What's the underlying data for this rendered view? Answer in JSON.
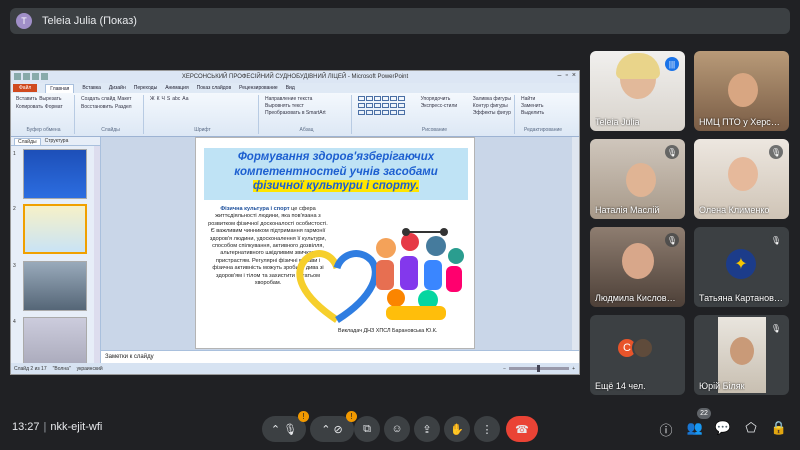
{
  "top": {
    "avatar_letter": "T",
    "title": "Teleia Julia (Показ)"
  },
  "powerpoint": {
    "window_title": "ХЕРСОНСЬКИЙ ПРОФЕСІЙНИЙ СУДНОБУДІВНИЙ ЛІЦЕЙ - Microsoft PowerPoint",
    "tabs": [
      "Файл",
      "Главная",
      "Вставка",
      "Дизайн",
      "Переходы",
      "Анимация",
      "Показ слайдов",
      "Рецензирование",
      "Вид"
    ],
    "ribbon_groups": [
      {
        "label": "Буфер обмена",
        "items": [
          "Вставить",
          "Вырезать",
          "Копировать",
          "Формат"
        ]
      },
      {
        "label": "Слайды",
        "items": [
          "Создать слайд",
          "Макет",
          "Восстановить",
          "Раздел"
        ]
      },
      {
        "label": "Шрифт",
        "items": [
          "Ж",
          "К",
          "Ч",
          "S",
          "abc",
          "Аа"
        ]
      },
      {
        "label": "Абзац",
        "items": [
          "Направление текста",
          "Выровнять текст",
          "Преобразовать в SmartArt"
        ]
      },
      {
        "label": "Рисование",
        "items": [
          "Упорядочить",
          "Экспресс-стили",
          "Заливка фигуры",
          "Контур фигуры",
          "Эффекты фигур"
        ]
      },
      {
        "label": "Редактирование",
        "items": [
          "Найти",
          "Заменить",
          "Выделить"
        ]
      }
    ],
    "pane_tabs": [
      "Слайды",
      "Структура"
    ],
    "thumb_numbers": [
      "1",
      "2",
      "3",
      "4"
    ],
    "slide": {
      "title_line1": "Формування здоров'язберігаючих",
      "title_line2": "компетентностей учнів засобами",
      "title_line3": "фізичної культури і спорту.",
      "body_lead": "Фізична культура і спорт",
      "body_rest": " це сфера життєдіяльності людини, яка пов'язана з розвитком фізичної досконалості особистості. Є важливим чинником підтримання гармонії здоров'я людини, удосконалення її культури, способом спілкування, активного дозвілля, альтернативного шкідливим звичкам пристрастям. Регулярні фізичні вправи і фізична активність можуть зробити дива зі здоров'ям і тілом та захистити багатьом хворобам.",
      "signature": "Викладач ДНЗ ХПСЛ Барановська Ю.К."
    },
    "notes_placeholder": "Заметки к слайду",
    "status": {
      "slide_info": "Слайд 2 из 17",
      "theme": "\"Волна\"",
      "language": "украинский"
    }
  },
  "participants": [
    {
      "name": "Teleia Julia",
      "mic": "speaking"
    },
    {
      "name": "НМЦ ПТО у Херсо…",
      "mic": ""
    },
    {
      "name": "Наталія Маслій",
      "mic": "muted"
    },
    {
      "name": "Олена Клименко",
      "mic": "muted"
    },
    {
      "name": "Людмила Кислов…",
      "mic": "muted"
    },
    {
      "name": "Татьяна Картанов…",
      "mic": "muted"
    },
    {
      "name": "Ещё 14 чел.",
      "mic": "",
      "avatar_letter": "C"
    },
    {
      "name": "Юрій Біляк",
      "mic": "muted"
    }
  ],
  "bottom": {
    "time": "13:27",
    "meeting_code": "nkk-ejit-wfi",
    "mic_badge": "!",
    "cam_badge": "!",
    "people_count": "22"
  },
  "icons": {
    "mic_off": "mic-off-icon",
    "cam_off": "camera-off-icon",
    "captions": "captions-icon",
    "emoji": "emoji-icon",
    "present": "present-icon",
    "hand": "raise-hand-icon",
    "more": "more-options-icon",
    "end": "end-call-icon",
    "info": "info-icon",
    "people": "people-icon",
    "chat": "chat-icon",
    "activities": "activities-icon",
    "lock": "host-controls-icon"
  },
  "colors": {
    "accent": "#1a73e8",
    "end_call": "#ea4335",
    "badge": "#f29900",
    "slide_title": "#1d5fd0",
    "highlight": "#ffe500"
  }
}
